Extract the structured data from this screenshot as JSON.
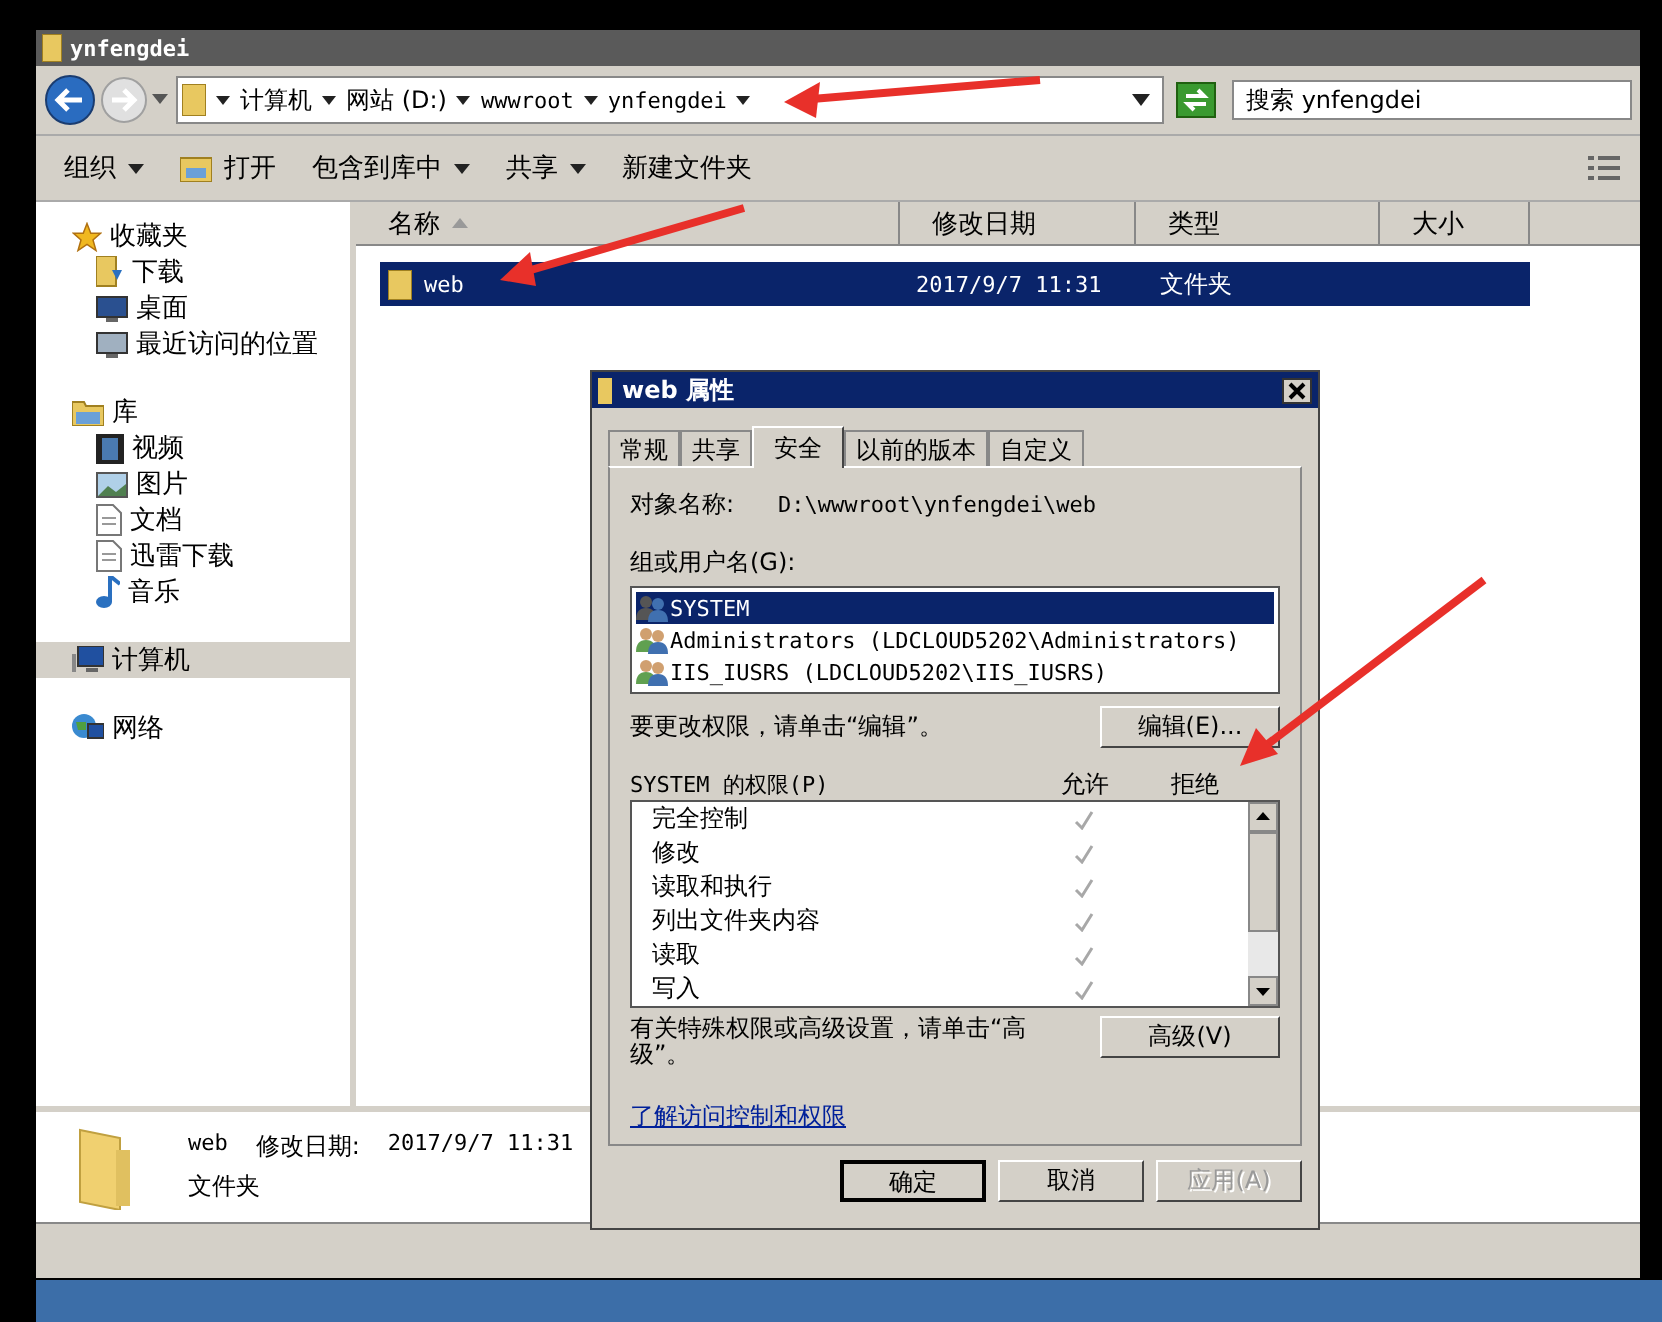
{
  "window": {
    "title": "ynfengdei"
  },
  "address_bar": {
    "crumbs": [
      "计算机",
      "网站 (D:)",
      "wwwroot",
      "ynfengdei"
    ],
    "search_placeholder": "搜索 ynfengdei"
  },
  "toolbar": [
    {
      "label": "组织",
      "kind": "menu"
    },
    {
      "label": "打开",
      "kind": "open"
    },
    {
      "label": "包含到库中",
      "kind": "menu"
    },
    {
      "label": "共享",
      "kind": "menu"
    },
    {
      "label": "新建文件夹",
      "kind": "plain"
    }
  ],
  "sidebar": {
    "groups": [
      {
        "label": "收藏夹",
        "kind": "star",
        "selected": false,
        "children": [
          {
            "label": "下载",
            "kind": "download",
            "selected": false
          },
          {
            "label": "桌面",
            "kind": "desktop",
            "selected": false
          },
          {
            "label": "最近访问的位置",
            "kind": "recent",
            "selected": false
          }
        ]
      },
      {
        "label": "库",
        "kind": "library",
        "selected": false,
        "children": [
          {
            "label": "视频",
            "kind": "video",
            "selected": false
          },
          {
            "label": "图片",
            "kind": "picture",
            "selected": false
          },
          {
            "label": "文档",
            "kind": "document",
            "selected": false
          },
          {
            "label": "迅雷下载",
            "kind": "document",
            "selected": false
          },
          {
            "label": "音乐",
            "kind": "music",
            "selected": false
          }
        ]
      },
      {
        "label": "计算机",
        "kind": "computer",
        "selected": true
      },
      {
        "label": "网络",
        "kind": "network",
        "selected": false
      }
    ]
  },
  "file_list": {
    "columns": [
      {
        "label": "名称",
        "sorted": true
      },
      {
        "label": "修改日期",
        "sorted": false
      },
      {
        "label": "类型",
        "sorted": false
      },
      {
        "label": "大小",
        "sorted": false
      }
    ],
    "rows": [
      {
        "name": "web",
        "modified": "2017/9/7 11:31",
        "type": "文件夹",
        "selected": true
      }
    ]
  },
  "details_pane": {
    "name": "web",
    "modified_label": "修改日期:",
    "modified": "2017/9/7 11:31",
    "type": "文件夹"
  },
  "dialog": {
    "title": "web 属性",
    "tabs": [
      {
        "label": "常规",
        "selected": false
      },
      {
        "label": "共享",
        "selected": false
      },
      {
        "label": "安全",
        "selected": true
      },
      {
        "label": "以前的版本",
        "selected": false
      },
      {
        "label": "自定义",
        "selected": false
      }
    ],
    "object_label": "对象名称:",
    "object_name": "D:\\wwwroot\\ynfengdei\\web",
    "groups_label": "组或用户名(G):",
    "users": [
      {
        "name": "SYSTEM",
        "kind": "system",
        "selected": true
      },
      {
        "name": "Administrators (LDCLOUD5202\\Administrators)",
        "kind": "group",
        "selected": false
      },
      {
        "name": "IIS_IUSRS (LDCLOUD5202\\IIS_IUSRS)",
        "kind": "group",
        "selected": false
      }
    ],
    "edit_hint": "要更改权限，请单击“编辑”。",
    "edit_button": "编辑(E)...",
    "permissions_label": "SYSTEM 的权限(P)",
    "allow_label": "允许",
    "deny_label": "拒绝",
    "permissions": [
      {
        "name": "完全控制",
        "allow": true
      },
      {
        "name": "修改",
        "allow": true
      },
      {
        "name": "读取和执行",
        "allow": true
      },
      {
        "name": "列出文件夹内容",
        "allow": true
      },
      {
        "name": "读取",
        "allow": true
      },
      {
        "name": "写入",
        "allow": true
      }
    ],
    "advanced_hint": "有关特殊权限或高级设置，请单击“高级”。",
    "advanced_button": "高级(V)",
    "link": "了解访问控制和权限",
    "buttons": [
      {
        "label": "确定",
        "disabled": false
      },
      {
        "label": "取消",
        "disabled": false
      },
      {
        "label": "应用(A)",
        "disabled": true
      }
    ]
  }
}
